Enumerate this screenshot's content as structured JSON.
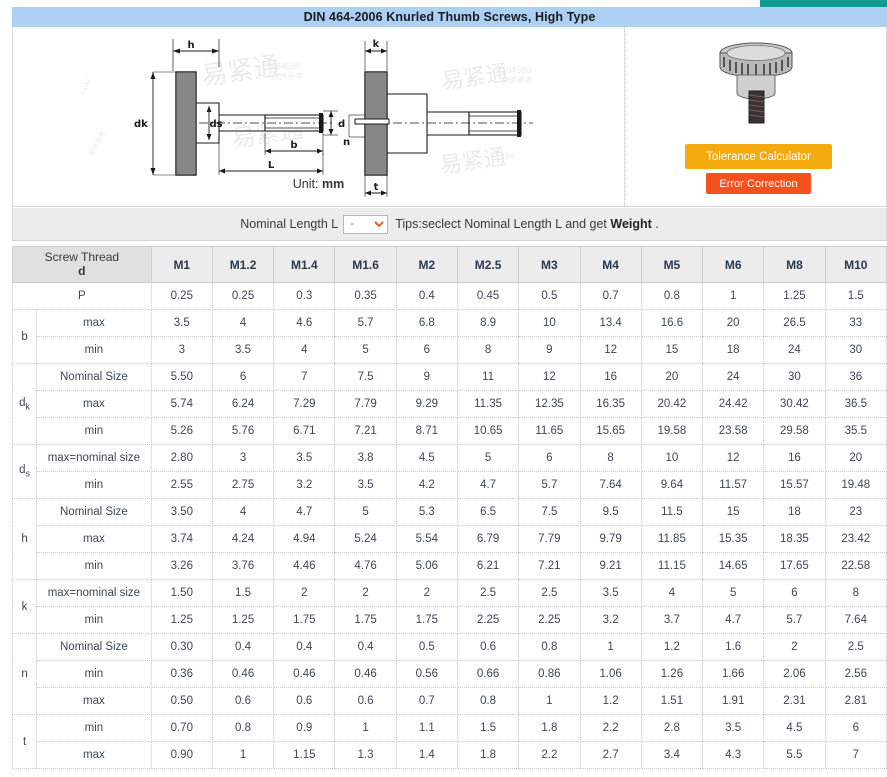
{
  "title": "DIN 464-2006 Knurled Thumb Screws, High Type",
  "drawing": {
    "unit_prefix": "Unit: ",
    "unit_value": "mm",
    "dimension_labels": [
      "h",
      "dk",
      "ds",
      "d",
      "b",
      "L",
      "k",
      "n",
      "t"
    ],
    "watermark": "易紧通"
  },
  "side_panel": {
    "product_image": "knurled-thumb-screw-render",
    "tolerance_button": "Tolerance Calculator",
    "error_button": "Error Correction",
    "tolerance_color": "#f5ab10",
    "error_color": "#f4511e"
  },
  "nominal_length": {
    "label": "Nominal Length L",
    "selected": "-",
    "options": [
      "-"
    ],
    "tip_text": "Tips:seclect Nominal Length L and get ",
    "tip_bold": "Weight",
    "tip_suffix": " ."
  },
  "table": {
    "header_line1": "Screw Thread",
    "header_line2": "d",
    "sizes": [
      "M1",
      "M1.2",
      "M1.4",
      "M1.6",
      "M2",
      "M2.5",
      "M3",
      "M4",
      "M5",
      "M6",
      "M8",
      "M10"
    ],
    "rows": [
      {
        "symbol": "P",
        "symbol_sub": "",
        "sublabel": "",
        "span_label": true,
        "values": [
          "0.25",
          "0.25",
          "0.3",
          "0.35",
          "0.4",
          "0.45",
          "0.5",
          "0.7",
          "0.8",
          "1",
          "1.25",
          "1.5"
        ]
      },
      {
        "symbol": "b",
        "symbol_sub": "",
        "sublabel": "max",
        "group_start": true,
        "group_size": 2,
        "values": [
          "3.5",
          "4",
          "4.6",
          "5.7",
          "6.8",
          "8.9",
          "10",
          "13.4",
          "16.6",
          "20",
          "26.5",
          "33"
        ]
      },
      {
        "symbol": "",
        "symbol_sub": "",
        "sublabel": "min",
        "values": [
          "3",
          "3.5",
          "4",
          "5",
          "6",
          "8",
          "9",
          "12",
          "15",
          "18",
          "24",
          "30"
        ]
      },
      {
        "symbol": "d",
        "symbol_sub": "k",
        "sublabel": "Nominal Size",
        "group_start": true,
        "group_size": 3,
        "values": [
          "5.50",
          "6",
          "7",
          "7.5",
          "9",
          "11",
          "12",
          "16",
          "20",
          "24",
          "30",
          "36"
        ]
      },
      {
        "symbol": "",
        "symbol_sub": "",
        "sublabel": "max",
        "values": [
          "5.74",
          "6.24",
          "7.29",
          "7.79",
          "9.29",
          "11.35",
          "12.35",
          "16.35",
          "20.42",
          "24.42",
          "30.42",
          "36.5"
        ]
      },
      {
        "symbol": "",
        "symbol_sub": "",
        "sublabel": "min",
        "values": [
          "5.26",
          "5.76",
          "6.71",
          "7.21",
          "8.71",
          "10.65",
          "11.65",
          "15.65",
          "19.58",
          "23.58",
          "29.58",
          "35.5"
        ]
      },
      {
        "symbol": "d",
        "symbol_sub": "s",
        "sublabel": "max=nominal size",
        "group_start": true,
        "group_size": 2,
        "values": [
          "2.80",
          "3",
          "3.5",
          "3.8",
          "4.5",
          "5",
          "6",
          "8",
          "10",
          "12",
          "16",
          "20"
        ]
      },
      {
        "symbol": "",
        "symbol_sub": "",
        "sublabel": "min",
        "values": [
          "2.55",
          "2.75",
          "3.2",
          "3.5",
          "4.2",
          "4.7",
          "5.7",
          "7.64",
          "9.64",
          "11.57",
          "15.57",
          "19.48"
        ]
      },
      {
        "symbol": "h",
        "symbol_sub": "",
        "sublabel": "Nominal Size",
        "group_start": true,
        "group_size": 3,
        "values": [
          "3.50",
          "4",
          "4.7",
          "5",
          "5.3",
          "6.5",
          "7.5",
          "9.5",
          "11.5",
          "15",
          "18",
          "23"
        ]
      },
      {
        "symbol": "",
        "symbol_sub": "",
        "sublabel": "max",
        "values": [
          "3.74",
          "4.24",
          "4.94",
          "5.24",
          "5.54",
          "6.79",
          "7.79",
          "9.79",
          "11.85",
          "15.35",
          "18.35",
          "23.42"
        ]
      },
      {
        "symbol": "",
        "symbol_sub": "",
        "sublabel": "min",
        "values": [
          "3.26",
          "3.76",
          "4.46",
          "4.76",
          "5.06",
          "6.21",
          "7.21",
          "9.21",
          "11.15",
          "14.65",
          "17.65",
          "22.58"
        ]
      },
      {
        "symbol": "k",
        "symbol_sub": "",
        "sublabel": "max=nominal size",
        "group_start": true,
        "group_size": 2,
        "values": [
          "1.50",
          "1.5",
          "2",
          "2",
          "2",
          "2.5",
          "2.5",
          "3.5",
          "4",
          "5",
          "6",
          "8"
        ]
      },
      {
        "symbol": "",
        "symbol_sub": "",
        "sublabel": "min",
        "values": [
          "1.25",
          "1.25",
          "1.75",
          "1.75",
          "1.75",
          "2.25",
          "2.25",
          "3.2",
          "3.7",
          "4.7",
          "5.7",
          "7.64"
        ]
      },
      {
        "symbol": "n",
        "symbol_sub": "",
        "sublabel": "Nominal Size",
        "group_start": true,
        "group_size": 3,
        "values": [
          "0.30",
          "0.4",
          "0.4",
          "0.4",
          "0.5",
          "0.6",
          "0.8",
          "1",
          "1.2",
          "1.6",
          "2",
          "2.5"
        ]
      },
      {
        "symbol": "",
        "symbol_sub": "",
        "sublabel": "min",
        "values": [
          "0.36",
          "0.46",
          "0.46",
          "0.46",
          "0.56",
          "0.66",
          "0.86",
          "1.06",
          "1.26",
          "1.66",
          "2.06",
          "2.56"
        ]
      },
      {
        "symbol": "",
        "symbol_sub": "",
        "sublabel": "max",
        "values": [
          "0.50",
          "0.6",
          "0.6",
          "0.6",
          "0.7",
          "0.8",
          "1",
          "1.2",
          "1.51",
          "1.91",
          "2.31",
          "2.81"
        ]
      },
      {
        "symbol": "t",
        "symbol_sub": "",
        "sublabel": "min",
        "group_start": true,
        "group_size": 2,
        "values": [
          "0.70",
          "0.8",
          "0.9",
          "1",
          "1.1",
          "1.5",
          "1.8",
          "2.2",
          "2.8",
          "3.5",
          "4.5",
          "6"
        ]
      },
      {
        "symbol": "",
        "symbol_sub": "",
        "sublabel": "max",
        "values": [
          "0.90",
          "1",
          "1.15",
          "1.3",
          "1.4",
          "1.8",
          "2.2",
          "2.7",
          "3.4",
          "4.3",
          "5.5",
          "7"
        ]
      }
    ]
  }
}
